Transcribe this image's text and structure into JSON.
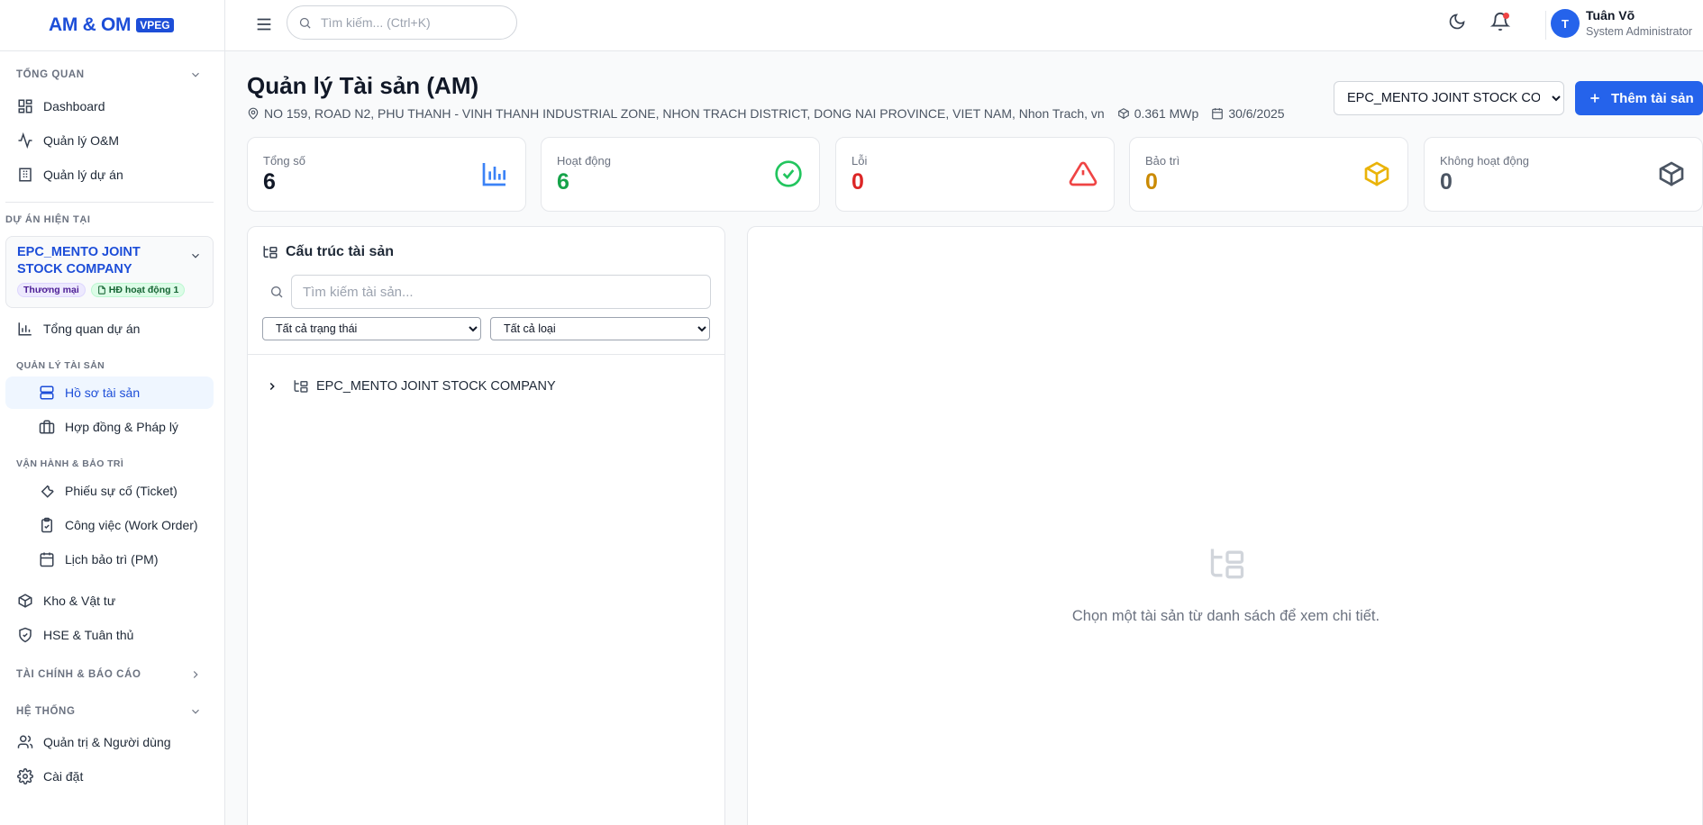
{
  "app": {
    "logo": "AM & OM",
    "logo_badge": "VPEG"
  },
  "topbar": {
    "search_placeholder": "Tìm kiếm... (Ctrl+K)",
    "user_initial": "T",
    "user_name": "Tuân Võ",
    "user_role": "System Administrator"
  },
  "sidebar": {
    "section_overview": "TỔNG QUAN",
    "dashboard": "Dashboard",
    "om": "Quản lý O&M",
    "projects": "Quản lý dự án",
    "section_current": "DỰ ÁN HIỆN TẠI",
    "project_name": "EPC_MENTO JOINT STOCK COMPANY",
    "badge_commercial": "Thương mại",
    "badge_contract": "HĐ hoạt động 1",
    "project_overview": "Tổng quan dự án",
    "section_asset": "QUẢN LÝ TÀI SẢN",
    "asset_records": "Hồ sơ tài sản",
    "contracts": "Hợp đồng & Pháp lý",
    "section_ops": "VẬN HÀNH & BẢO TRÌ",
    "tickets": "Phiếu sự cố (Ticket)",
    "work_orders": "Công việc (Work Order)",
    "pm": "Lịch bảo trì (PM)",
    "warehouse": "Kho & Vật tư",
    "hse": "HSE & Tuân thủ",
    "section_finance": "TÀI CHÍNH & BÁO CÁO",
    "section_system": "HỆ THỐNG",
    "admin_users": "Quản trị & Người dùng",
    "settings": "Cài đặt"
  },
  "page": {
    "title": "Quản lý Tài sản (AM)",
    "address": "NO 159, ROAD N2, PHU THANH - VINH THANH INDUSTRIAL ZONE, NHON TRACH DISTRICT, DONG NAI PROVINCE, VIET NAM, Nhon Trach, vn",
    "capacity": "0.361 MWp",
    "date": "30/6/2025",
    "company_select": "EPC_MENTO JOINT STOCK COMPANY",
    "add_button": "Thêm tài sản"
  },
  "stats": {
    "total_label": "Tổng số",
    "total_value": "6",
    "active_label": "Hoạt động",
    "active_value": "6",
    "error_label": "Lỗi",
    "error_value": "0",
    "maint_label": "Bảo trì",
    "maint_value": "0",
    "inactive_label": "Không hoạt động",
    "inactive_value": "0"
  },
  "tree": {
    "title": "Cấu trúc tài sản",
    "search_placeholder": "Tìm kiếm tài sản...",
    "filter_status": "Tất cả trạng thái",
    "filter_type": "Tất cả loại",
    "root_node": "EPC_MENTO JOINT STOCK COMPANY"
  },
  "detail": {
    "empty_message": "Chọn một tài sản từ danh sách để xem chi tiết."
  },
  "colors": {
    "primary": "#2563eb",
    "active": "#16a34a",
    "error": "#dc2626",
    "maintenance": "#ca8a04",
    "inactive": "#4b5563"
  }
}
